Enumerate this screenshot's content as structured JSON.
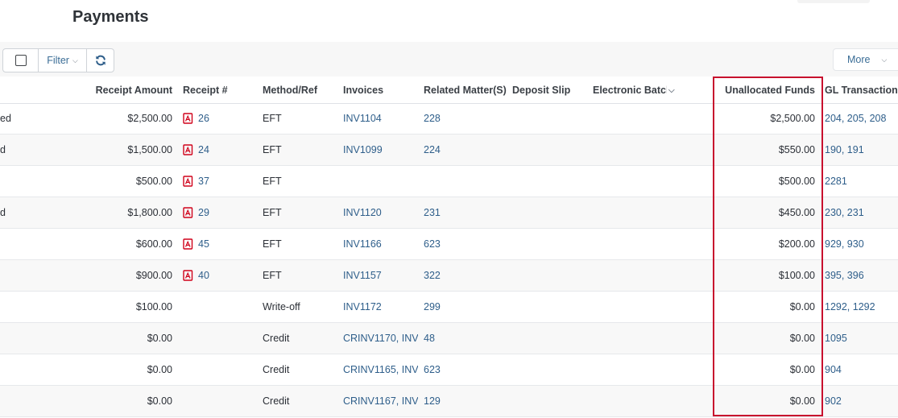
{
  "page": {
    "title": "Payments"
  },
  "toolbar": {
    "filter_label": "Filter",
    "more_label": "More"
  },
  "columns": {
    "amount": "Receipt Amount",
    "receipt": "Receipt #",
    "method": "Method/Ref",
    "invoices": "Invoices",
    "matter": "Related Matter(S)",
    "deposit": "Deposit Slip",
    "batch": "Electronic Batch",
    "unallocated": "Unallocated Funds",
    "gl": "GL Transactions"
  },
  "rows": [
    {
      "status": "ed",
      "amount": "$2,500.00",
      "receipt": "26",
      "method": "EFT",
      "invoice": "INV1104",
      "matter": "228",
      "unallocated": "$2,500.00",
      "gl": "204, 205, 208"
    },
    {
      "status": "d",
      "amount": "$1,500.00",
      "receipt": "24",
      "method": "EFT",
      "invoice": "INV1099",
      "matter": "224",
      "unallocated": "$550.00",
      "gl": "190, 191"
    },
    {
      "status": "",
      "amount": "$500.00",
      "receipt": "37",
      "method": "EFT",
      "invoice": "",
      "matter": "",
      "unallocated": "$500.00",
      "gl": "2281"
    },
    {
      "status": "d",
      "amount": "$1,800.00",
      "receipt": "29",
      "method": "EFT",
      "invoice": "INV1120",
      "matter": "231",
      "unallocated": "$450.00",
      "gl": "230, 231"
    },
    {
      "status": "",
      "amount": "$600.00",
      "receipt": "45",
      "method": "EFT",
      "invoice": "INV1166",
      "matter": "623",
      "unallocated": "$200.00",
      "gl": "929, 930"
    },
    {
      "status": "",
      "amount": "$900.00",
      "receipt": "40",
      "method": "EFT",
      "invoice": "INV1157",
      "matter": "322",
      "unallocated": "$100.00",
      "gl": "395, 396"
    },
    {
      "status": "",
      "amount": "$100.00",
      "receipt": "",
      "method": "Write-off",
      "invoice": "INV1172",
      "matter": "299",
      "unallocated": "$0.00",
      "gl": "1292, 1292"
    },
    {
      "status": "",
      "amount": "$0.00",
      "receipt": "",
      "method": "Credit",
      "invoice": "CRINV1170, INV",
      "matter": "48",
      "unallocated": "$0.00",
      "gl": "1095"
    },
    {
      "status": "",
      "amount": "$0.00",
      "receipt": "",
      "method": "Credit",
      "invoice": "CRINV1165, INV",
      "matter": "623",
      "unallocated": "$0.00",
      "gl": "904"
    },
    {
      "status": "",
      "amount": "$0.00",
      "receipt": "",
      "method": "Credit",
      "invoice": "CRINV1167, INV",
      "matter": "129",
      "unallocated": "$0.00",
      "gl": "902"
    }
  ],
  "icons": {
    "receipt": "pdf-icon",
    "refresh": "refresh-icon",
    "filter_caret": "chevron-down-icon",
    "sort": "chevron-down-icon"
  },
  "colors": {
    "highlight": "#c8102e",
    "link": "#2e5e8a",
    "pdf": "#d0021b"
  }
}
